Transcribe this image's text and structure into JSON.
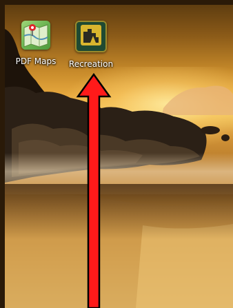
{
  "home_screen": {
    "apps": [
      {
        "label": "PDF Maps",
        "icon": "pdf-maps-icon"
      },
      {
        "label": "Recreation",
        "icon": "recreation-icon"
      }
    ],
    "wallpaper": "sunset-beach-rocks",
    "annotation": {
      "icon": "arrow-up-icon",
      "color": "#ff1a1a"
    }
  }
}
